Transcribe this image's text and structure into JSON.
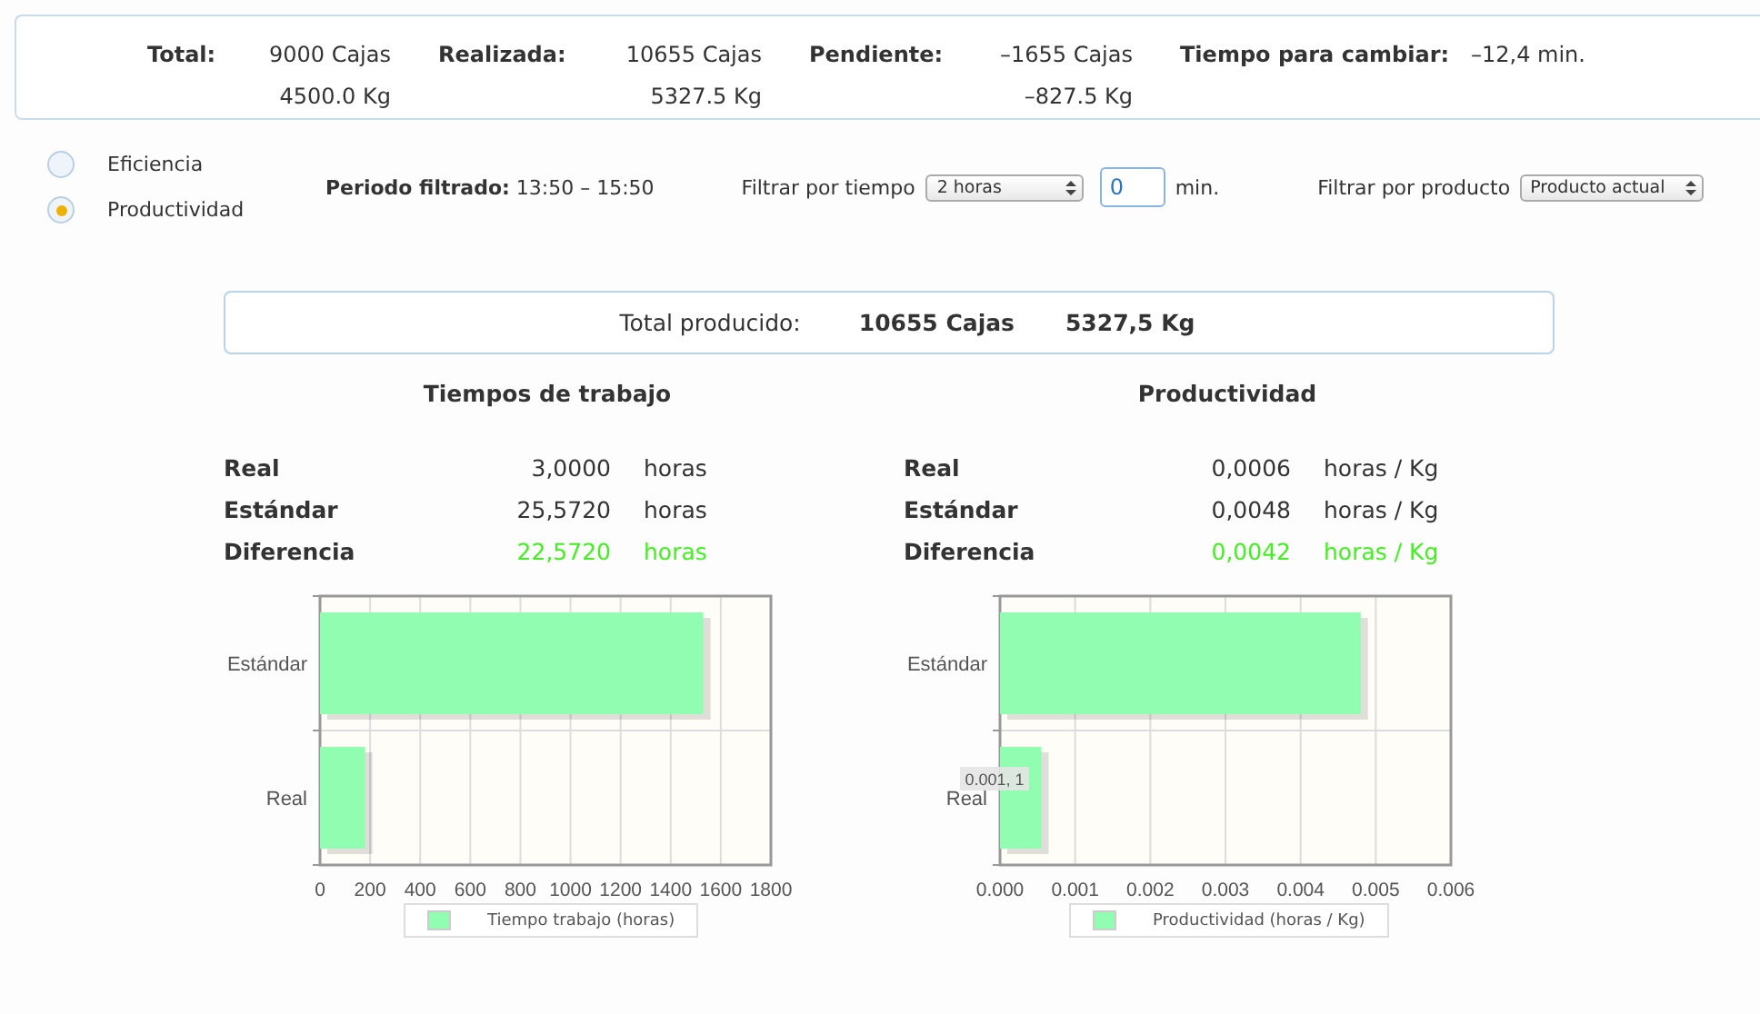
{
  "summary": [
    {
      "label": "Total:",
      "values": [
        "9000 Cajas",
        "4500.0 Kg"
      ]
    },
    {
      "label": "Realizada:",
      "values": [
        "10655 Cajas",
        "5327.5 Kg"
      ]
    },
    {
      "label": "Pendiente:",
      "values": [
        "–1655 Cajas",
        "–827.5 Kg"
      ]
    },
    {
      "label": "Tiempo para cambiar:",
      "values": [
        "–12,4 min."
      ]
    }
  ],
  "mode_options": [
    {
      "label": "Eficiencia",
      "selected": false
    },
    {
      "label": "Productividad",
      "selected": true
    }
  ],
  "period": {
    "label": "Periodo filtrado:",
    "value": "13:50 – 15:50"
  },
  "time_filter": {
    "label": "Filtrar por tiempo",
    "value": "2 horas",
    "minutes": "0",
    "unit": "min."
  },
  "product_filter": {
    "label": "Filtrar por producto",
    "value": "Producto actual"
  },
  "total_produced": {
    "label": "Total producido:",
    "boxes": "10655 Cajas",
    "weight": "5327,5 Kg"
  },
  "panels": [
    {
      "title": "Tiempos de trabajo",
      "rows": [
        {
          "label": "Real",
          "value": "3,0000",
          "unit": "horas",
          "highlighted": false
        },
        {
          "label": "Estándar",
          "value": "25,5720",
          "unit": "horas",
          "highlighted": false
        },
        {
          "label": "Diferencia",
          "value": "22,5720",
          "unit": "horas",
          "highlighted": true
        }
      ],
      "chart_data": {
        "type": "bar",
        "orientation": "horizontal",
        "grid": true,
        "categories": [
          "Estándar",
          "Real"
        ],
        "xlim": [
          0,
          1800
        ],
        "xticks": [
          0,
          200,
          400,
          600,
          800,
          1000,
          1200,
          1400,
          1600,
          1800
        ],
        "series": [
          {
            "name": "Tiempo trabajo (horas)",
            "color": "#90fdb0",
            "values": [
              1530,
              180
            ]
          }
        ]
      }
    },
    {
      "title": "Productividad",
      "rows": [
        {
          "label": "Real",
          "value": "0,0006",
          "unit": "horas / Kg",
          "highlighted": false
        },
        {
          "label": "Estándar",
          "value": "0,0048",
          "unit": "horas / Kg",
          "highlighted": false
        },
        {
          "label": "Diferencia",
          "value": "0,0042",
          "unit": "horas / Kg",
          "highlighted": true
        }
      ],
      "tooltip": "0.001, 1",
      "chart_data": {
        "type": "bar",
        "orientation": "horizontal",
        "grid": true,
        "categories": [
          "Estándar",
          "Real"
        ],
        "xlim": [
          0,
          0.006
        ],
        "xticks": [
          {
            "value": 0,
            "label": "0.000"
          },
          {
            "value": 0.001,
            "label": "0.001"
          },
          {
            "value": 0.002,
            "label": "0.002"
          },
          {
            "value": 0.003,
            "label": "0.003"
          },
          {
            "value": 0.004,
            "label": "0.004"
          },
          {
            "value": 0.005,
            "label": "0.005"
          },
          {
            "value": 0.006,
            "label": "0.006"
          }
        ],
        "series": [
          {
            "name": "Productividad (horas / Kg)",
            "color": "#90fdb0",
            "values": [
              0.0048,
              0.00055
            ]
          }
        ]
      }
    }
  ]
}
